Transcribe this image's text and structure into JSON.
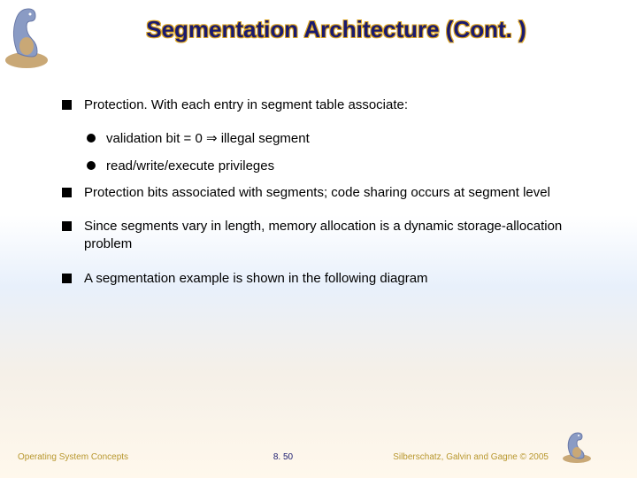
{
  "title": "Segmentation Architecture (Cont. )",
  "bullets": {
    "item0": "Protection.  With each entry in segment table associate:",
    "sub0": "validation bit = 0 ⇒ illegal segment",
    "sub1": "read/write/execute privileges",
    "item1": "Protection bits associated with segments; code sharing occurs at segment level",
    "item2": "Since segments vary in length, memory allocation is a dynamic storage-allocation problem",
    "item3": "A segmentation example is shown in the following diagram"
  },
  "footer": {
    "left": "Operating System Concepts",
    "center": "8. 50",
    "right": "Silberschatz, Galvin and Gagne © 2005"
  }
}
